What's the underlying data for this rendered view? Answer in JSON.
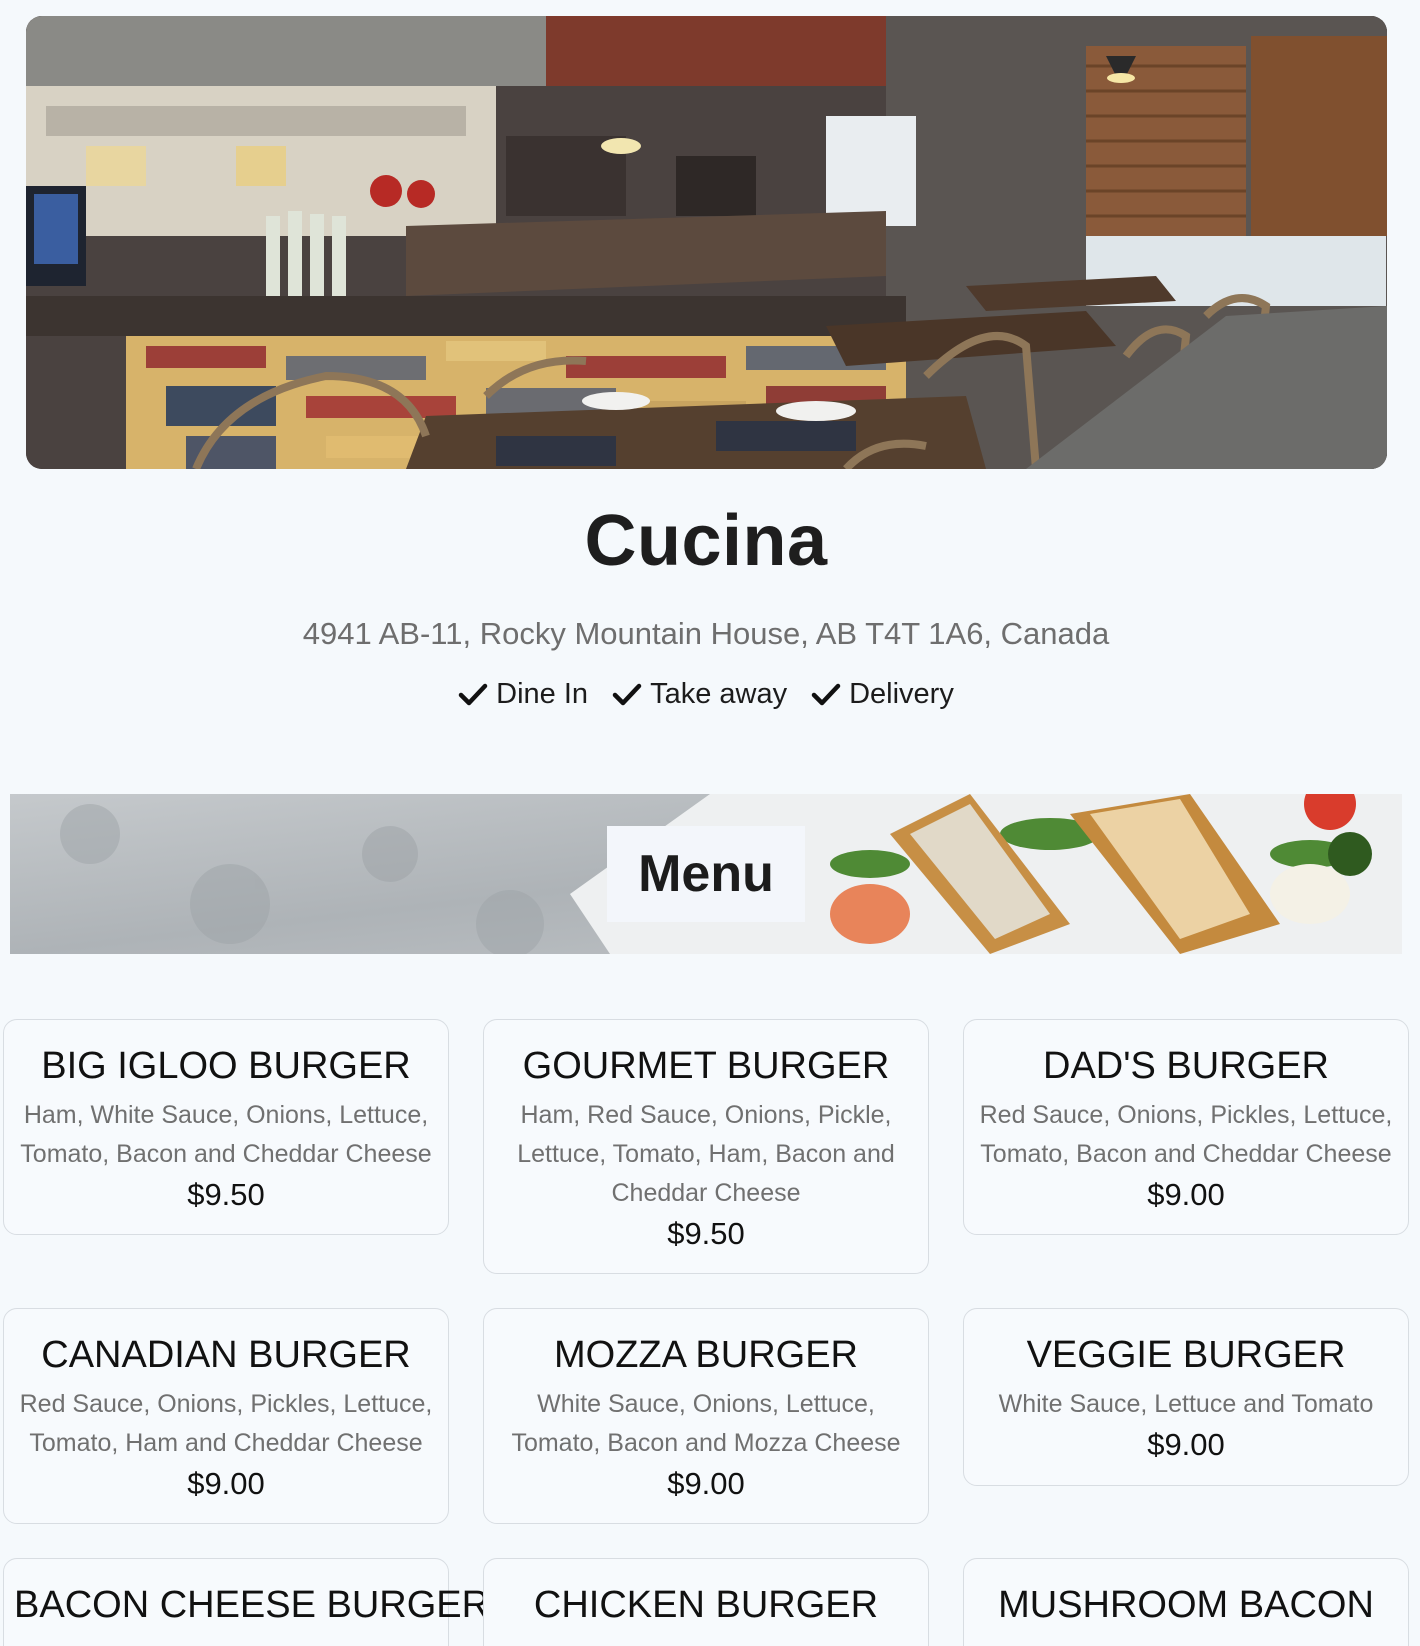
{
  "restaurant": {
    "name": "Cucina",
    "address": "4941 AB-11, Rocky Mountain House, AB T4T 1A6, Canada",
    "services": [
      "Dine In",
      "Take away",
      "Delivery"
    ]
  },
  "menu": {
    "heading": "Menu",
    "items": [
      {
        "name": "BIG IGLOO BURGER",
        "description": "Ham, White Sauce, Onions, Lettuce, Tomato, Bacon and Cheddar Cheese",
        "price": "$9.50"
      },
      {
        "name": "GOURMET BURGER",
        "description": "Ham, Red Sauce, Onions, Pickle, Lettuce, Tomato, Ham, Bacon and Cheddar Cheese",
        "price": "$9.50"
      },
      {
        "name": "DAD'S BURGER",
        "description": "Red Sauce, Onions, Pickles, Lettuce, Tomato, Bacon and Cheddar Cheese",
        "price": "$9.00"
      },
      {
        "name": "CANADIAN BURGER",
        "description": "Red Sauce, Onions, Pickles, Lettuce, Tomato, Ham and Cheddar Cheese",
        "price": "$9.00"
      },
      {
        "name": "MOZZA BURGER",
        "description": "White Sauce, Onions, Lettuce, Tomato, Bacon and Mozza Cheese",
        "price": "$9.00"
      },
      {
        "name": "VEGGIE BURGER",
        "description": "White Sauce, Lettuce and Tomato",
        "price": "$9.00"
      },
      {
        "name": "BACON CHEESE BURGER",
        "description": "",
        "price": ""
      },
      {
        "name": "CHICKEN BURGER",
        "description": "",
        "price": ""
      },
      {
        "name": "MUSHROOM BACON",
        "description": "",
        "price": ""
      }
    ]
  },
  "colors": {
    "background": "#f5f9fc",
    "text": "#1c1c1c",
    "muted_text": "#707070",
    "card_border": "#d8dde2"
  },
  "icons": {
    "service_check": "check-icon"
  }
}
